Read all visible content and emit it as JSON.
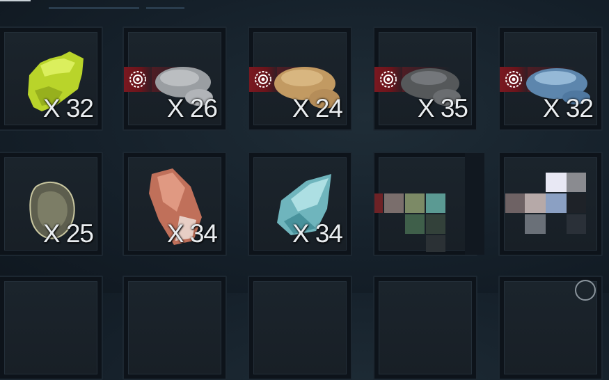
{
  "inventory": {
    "colors": {
      "rarity_badge": "#7a1820",
      "slot_bg": "#0d131a",
      "quantity_text": "#e9edf0"
    },
    "rows": [
      [
        {
          "item": "sulfur-ore",
          "quantity": "X 32",
          "rare": false
        },
        {
          "item": "grey-stone",
          "quantity": "X 26",
          "rare": true
        },
        {
          "item": "sandstone",
          "quantity": "X 24",
          "rare": true
        },
        {
          "item": "coal-ore",
          "quantity": "X 35",
          "rare": true
        },
        {
          "item": "blue-ore",
          "quantity": "X 32",
          "rare": true
        }
      ],
      [
        {
          "item": "pyrite-ore",
          "quantity": "X 25",
          "rare": false
        },
        {
          "item": "rose-quartz",
          "quantity": "X 34",
          "rare": false
        },
        {
          "item": "cyan-crystal",
          "quantity": "X 34",
          "rare": false
        },
        {
          "item": "pixelated-item",
          "quantity": "",
          "rare": false
        },
        {
          "item": "pixelated-item",
          "quantity": "",
          "rare": false
        }
      ]
    ]
  }
}
